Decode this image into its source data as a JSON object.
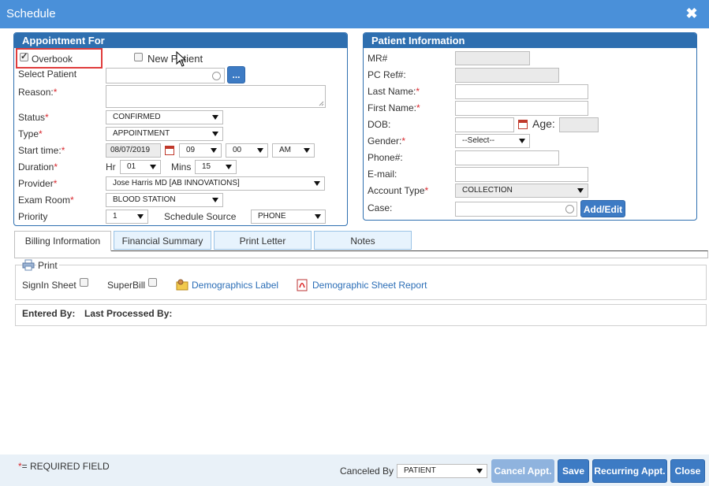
{
  "window": {
    "title": "Schedule",
    "close_glyph": "✖"
  },
  "appointment": {
    "header": "Appointment For",
    "overbook_label": "Overbook",
    "new_patient_label": "New Patient",
    "select_patient_label": "Select Patient",
    "select_patient_button": "...",
    "reason_label": "Reason:",
    "status_label": "Status",
    "status_value": "CONFIRMED",
    "type_label": "Type",
    "type_value": "APPOINTMENT",
    "start_time_label": "Start time:",
    "start_date": "08/07/2019",
    "start_hour": "09",
    "start_min": "00",
    "start_ampm": "AM",
    "duration_label": "Duration",
    "hr_label": "Hr",
    "hr_value": "01",
    "mins_label": "Mins",
    "mins_value": "15",
    "provider_label": "Provider",
    "provider_value": "Jose Harris MD [AB INNOVATIONS]",
    "exam_room_label": "Exam Room",
    "exam_room_value": "BLOOD STATION",
    "priority_label": "Priority",
    "priority_value": "1",
    "schedule_source_label": "Schedule Source",
    "schedule_source_value": "PHONE",
    "required_mark": "*"
  },
  "patient": {
    "header": "Patient Information",
    "mr_label": "MR#",
    "pc_ref_label": "PC Ref#:",
    "last_name_label": "Last Name:",
    "first_name_label": "First Name:",
    "dob_label": "DOB:",
    "age_label": "Age:",
    "gender_label": "Gender:",
    "gender_value": "--Select--",
    "phone_label": "Phone#:",
    "email_label": "E-mail:",
    "account_type_label": "Account Type",
    "account_type_value": "COLLECTION",
    "case_label": "Case:",
    "add_edit_button": "Add/Edit"
  },
  "tabs": [
    {
      "label": "Billing Information"
    },
    {
      "label": "Financial Summary"
    },
    {
      "label": "Print Letter"
    },
    {
      "label": "Notes"
    }
  ],
  "print": {
    "legend": "Print",
    "signin_sheet_label": "SignIn Sheet",
    "superbill_label": "SuperBill",
    "demographics_label_link": "Demographics Label",
    "demographic_sheet_link": "Demographic Sheet Report"
  },
  "entered": {
    "entered_by_label": "Entered By:",
    "last_processed_label": "Last Processed By:"
  },
  "footer": {
    "required_note": "= REQUIRED FIELD",
    "required_star": "*",
    "canceled_by_label": "Canceled By",
    "canceled_by_value": "PATIENT",
    "cancel_appt_button": "Cancel Appt.",
    "save_button": "Save",
    "recurring_button": "Recurring Appt.",
    "close_button": "Close"
  },
  "colors": {
    "titlebar": "#4a90d9",
    "panel_header": "#2e6fb0",
    "highlight_box": "#e03c3c",
    "required": "#d9282e"
  }
}
